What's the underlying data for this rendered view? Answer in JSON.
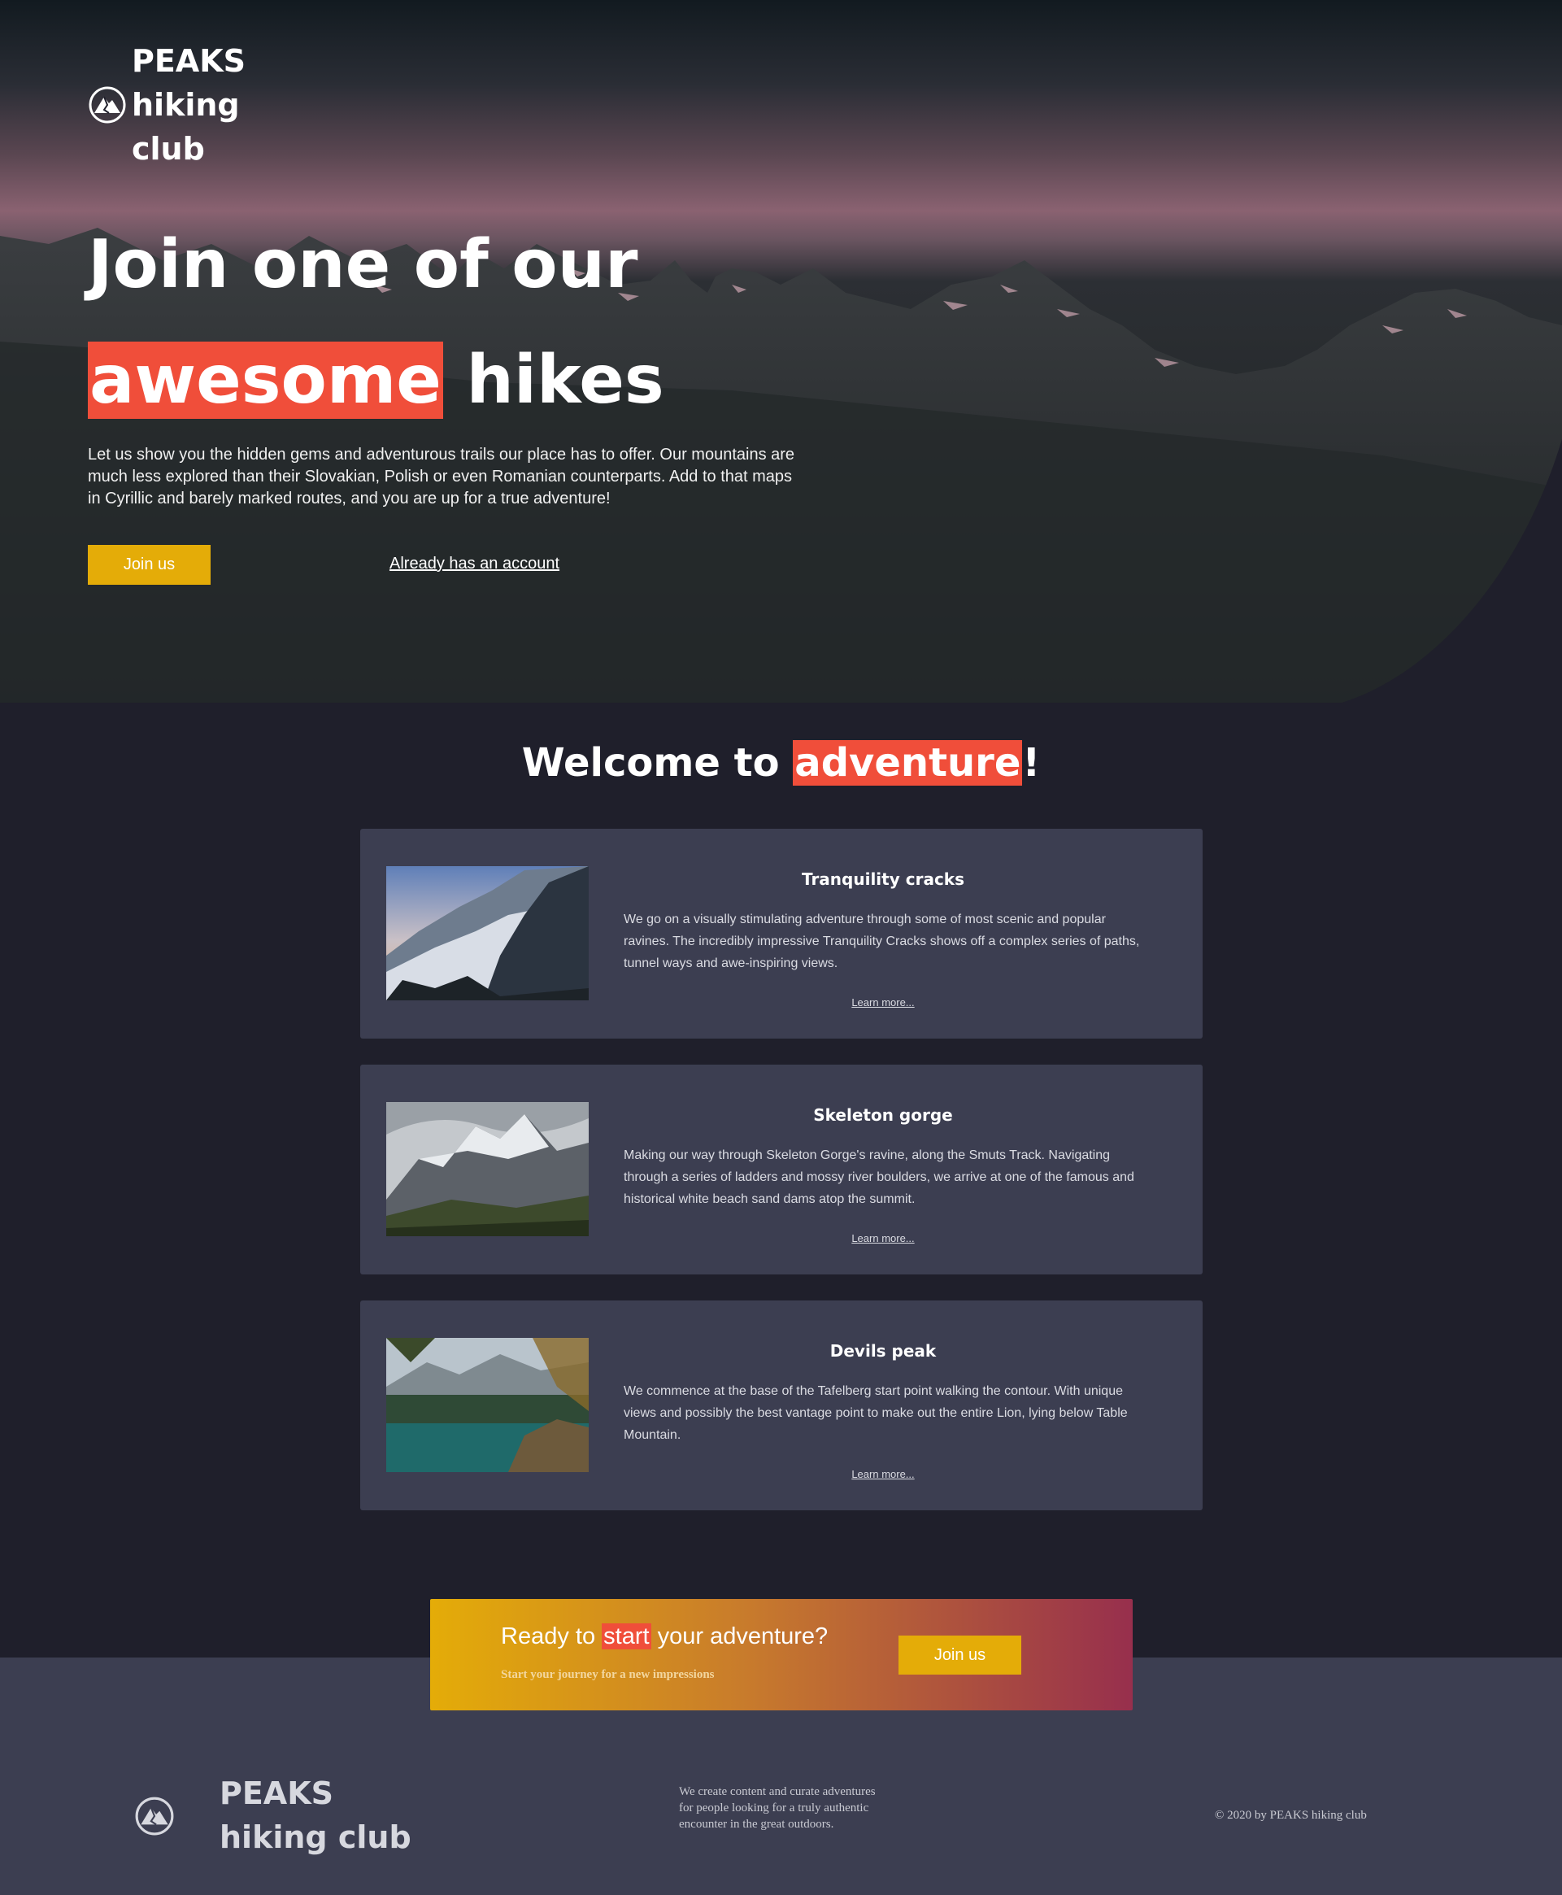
{
  "brand": {
    "name": "PEAKS hiking club"
  },
  "hero": {
    "title_line1": "Join one of our",
    "title_highlight": "awesome",
    "title_rest": "hikes",
    "text": "Let us show you the hidden gems and adventurous trails our place has to offer. Our mountains are much less explored than their Slovakian, Polish or even Romanian counterparts. Add to that maps in Cyrillic and barely marked routes, and you are up for a true adventure!",
    "join_label": "Join us",
    "login_label": "Already has an account"
  },
  "welcome": {
    "prefix": "Welcome to ",
    "highlight": "adventure",
    "suffix": "!"
  },
  "cards": [
    {
      "title": "Tranquility cracks",
      "text": "We go on a visually stimulating adventure through some of most scenic and popular ravines. The incredibly impressive Tranquility Cracks shows off a complex series of paths, tunnel ways and awe-inspiring views.",
      "link": "Learn more..."
    },
    {
      "title": "Skeleton gorge",
      "text": "Making our way through Skeleton Gorge's ravine, along the Smuts Track. Navigating through a series of ladders and mossy river boulders, we arrive at one of the famous and historical white beach sand dams atop the summit.",
      "link": "Learn more..."
    },
    {
      "title": "Devils peak",
      "text": "We commence at the base of the Tafelberg start point walking the contour. With unique views and possibly the best vantage point to make out the entire Lion, lying below Table Mountain.",
      "link": "Learn more..."
    }
  ],
  "cta": {
    "prefix": "Ready to ",
    "highlight": "start",
    "suffix": " your adventure?",
    "sub": "Start your journey for a new impressions",
    "join_label": "Join us"
  },
  "footer": {
    "name": "PEAKS hiking club",
    "description": "We create content and curate adventures for people looking for a truly authentic encounter in the great outdoors.",
    "copyright": "© 2020 by PEAKS hiking club"
  },
  "colors": {
    "accent": "#f04e3a",
    "button": "#e4ac08",
    "background": "#1f1f2b",
    "card": "#3c3e51"
  },
  "icons": {
    "logo": "mountain-logo-icon"
  }
}
